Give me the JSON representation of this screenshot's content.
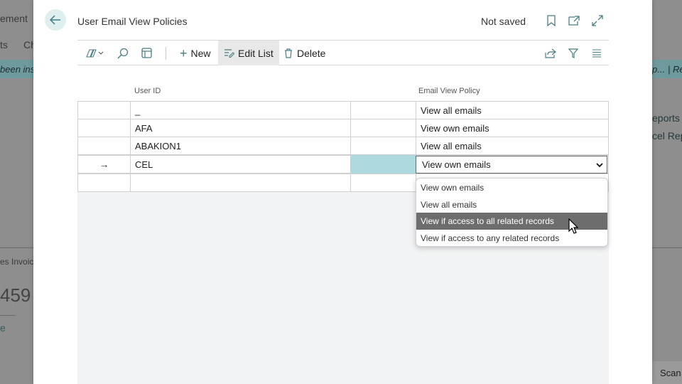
{
  "background": {
    "top_left": "ement",
    "nav_left": "ts",
    "nav_left2": "Ch",
    "strip_left": "been ins",
    "strip_right": "p...",
    "strip_right2": "| Re",
    "reports_label": "eports",
    "excel_label": "cel Rep",
    "invoice_label": "es Invoic",
    "big_number": "459",
    "link_e": "e",
    "scan_label": "Scan"
  },
  "dialog": {
    "title": "User Email View Policies",
    "status": "Not saved"
  },
  "toolbar": {
    "new_label": "New",
    "edit_list_label": "Edit List",
    "delete_label": "Delete"
  },
  "grid": {
    "headers": {
      "user_id": "User ID",
      "policy": "Email View Policy"
    },
    "rows": [
      {
        "marker": "",
        "user_id": "_",
        "policy": "View all emails"
      },
      {
        "marker": "",
        "user_id": "AFA",
        "policy": "View own emails"
      },
      {
        "marker": "",
        "user_id": "ABAKION1",
        "policy": "View all emails"
      },
      {
        "marker": "→",
        "user_id": "CEL",
        "policy": "View own emails"
      },
      {
        "marker": "",
        "user_id": "",
        "policy": ""
      }
    ]
  },
  "dropdown": {
    "selected": "View own emails",
    "options": [
      "View own emails",
      "View all emails",
      "View if access to all related records",
      "View if access to any related records"
    ],
    "highlighted_index": 2
  },
  "colors": {
    "accent_teal": "#aed9de",
    "highlight_gray": "#6d6d6d"
  }
}
